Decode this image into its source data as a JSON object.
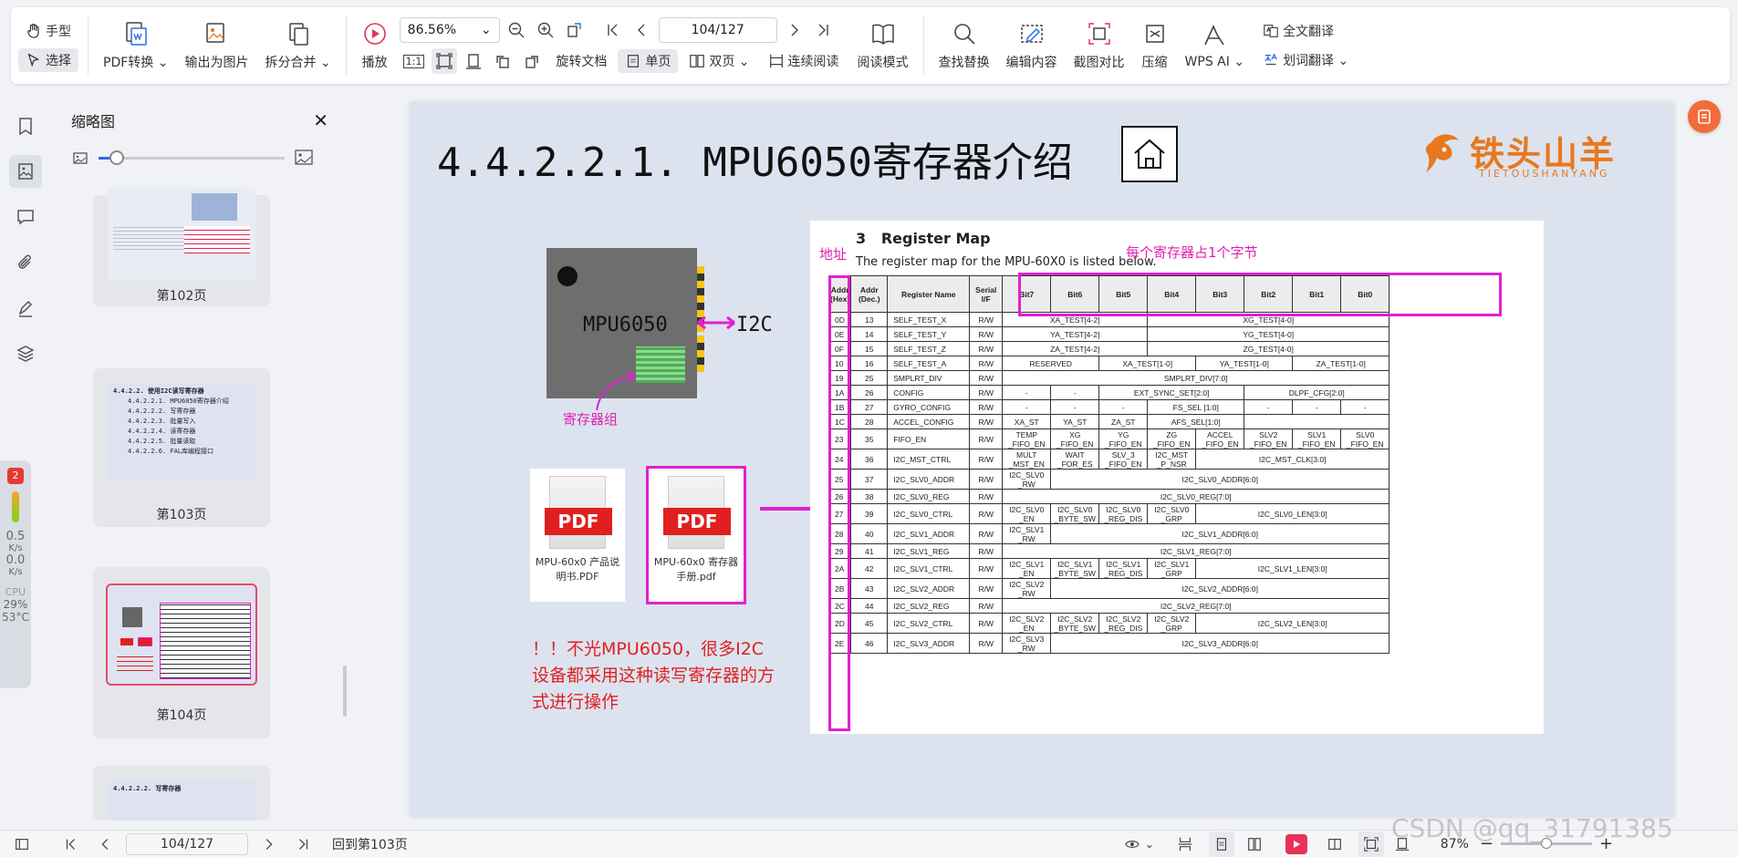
{
  "toolbar": {
    "hand_label": "手型",
    "select_label": "选择",
    "pdf_convert_label": "PDF转换",
    "export_image_label": "输出为图片",
    "split_merge_label": "拆分合并",
    "play_label": "播放",
    "zoom_value": "86.56%",
    "page_value": "104/127",
    "actual_size_label": "1:1",
    "rotate_doc_label": "旋转文档",
    "single_page_label": "单页",
    "double_page_label": "双页",
    "continuous_label": "连续阅读",
    "read_mode_label": "阅读模式",
    "find_replace_label": "查找替换",
    "edit_content_label": "编辑内容",
    "screenshot_compare_label": "截图对比",
    "compress_label": "压缩",
    "wps_ai_label": "WPS AI",
    "full_translate_label": "全文翻译",
    "word_translate_label": "划词翻译"
  },
  "thumbnail_panel": {
    "title": "缩略图",
    "slider_value": 0.1,
    "pages": [
      {
        "label": "第102页",
        "lines": []
      },
      {
        "label": "第103页",
        "lines": [
          "4.4.2.2. 使用I2C读写寄存器",
          "4.4.2.2.1. MPU6050寄存器介绍",
          "4.4.2.2.2. 写寄存器",
          "4.4.2.2.3. 批量写入",
          "4.4.2.2.4. 读寄存器",
          "4.4.2.2.5. 批量读取",
          "4.4.2.2.6. FAL库编程接口"
        ]
      },
      {
        "label": "第104页",
        "lines": []
      },
      {
        "label": "",
        "lines": [
          "4.4.2.2.2. 写寄存器"
        ]
      }
    ]
  },
  "monitor": {
    "badge": "2",
    "up_rate": "0.5",
    "up_unit": "K/s",
    "down_rate": "0.0",
    "down_unit": "K/s",
    "cpu_label": "CPU",
    "cpu_percent": "29%",
    "cpu_temp": "53°C"
  },
  "page": {
    "title": "4.4.2.2.1. MPU6050寄存器介绍",
    "logo_text": "铁头山羊",
    "logo_sub": "TIETOUSHANYANG",
    "chip_label": "MPU6050",
    "i2c_label": "I2C",
    "register_group_label": "寄存器组",
    "pdf1_caption": "MPU-60x0 产品说明书.PDF",
    "pdf2_caption": "MPU-60x0 寄存器手册.pdf",
    "pdf_badge": "PDF",
    "note": "！！不光MPU6050，很多I2C设备都采用这种读写寄存器的方式进行操作",
    "address_label": "地址",
    "byte_label": "每个寄存器占1个字节"
  },
  "register_map": {
    "heading_num": "3",
    "heading": "Register Map",
    "subtitle": "The register map for the MPU-60X0 is listed below.",
    "columns": [
      "Addr (Hex)",
      "Addr (Dec.)",
      "Register Name",
      "Serial I/F",
      "Bit7",
      "Bit6",
      "Bit5",
      "Bit4",
      "Bit3",
      "Bit2",
      "Bit1",
      "Bit0"
    ],
    "rows": [
      {
        "hex": "0D",
        "dec": "13",
        "name": "SELF_TEST_X",
        "rw": "R/W",
        "cells": [
          [
            "XA_TEST[4-2]",
            3
          ],
          [
            "XG_TEST[4-0]",
            5
          ]
        ]
      },
      {
        "hex": "0E",
        "dec": "14",
        "name": "SELF_TEST_Y",
        "rw": "R/W",
        "cells": [
          [
            "YA_TEST[4-2]",
            3
          ],
          [
            "YG_TEST[4-0]",
            5
          ]
        ]
      },
      {
        "hex": "0F",
        "dec": "15",
        "name": "SELF_TEST_Z",
        "rw": "R/W",
        "cells": [
          [
            "ZA_TEST[4-2]",
            3
          ],
          [
            "ZG_TEST[4-0]",
            5
          ]
        ]
      },
      {
        "hex": "10",
        "dec": "16",
        "name": "SELF_TEST_A",
        "rw": "R/W",
        "cells": [
          [
            "RESERVED",
            2
          ],
          [
            "XA_TEST[1-0]",
            2
          ],
          [
            "YA_TEST[1-0]",
            2
          ],
          [
            "ZA_TEST[1-0]",
            2
          ]
        ]
      },
      {
        "hex": "19",
        "dec": "25",
        "name": "SMPLRT_DIV",
        "rw": "R/W",
        "cells": [
          [
            "SMPLRT_DIV[7:0]",
            8
          ]
        ]
      },
      {
        "hex": "1A",
        "dec": "26",
        "name": "CONFIG",
        "rw": "R/W",
        "cells": [
          [
            "-",
            1
          ],
          [
            "-",
            1
          ],
          [
            "EXT_SYNC_SET[2:0]",
            3
          ],
          [
            "DLPF_CFG[2:0]",
            3
          ]
        ]
      },
      {
        "hex": "1B",
        "dec": "27",
        "name": "GYRO_CONFIG",
        "rw": "R/W",
        "cells": [
          [
            "-",
            1
          ],
          [
            "-",
            1
          ],
          [
            "-",
            1
          ],
          [
            "FS_SEL [1:0]",
            2
          ],
          [
            "-",
            1
          ],
          [
            "-",
            1
          ],
          [
            "-",
            1
          ]
        ]
      },
      {
        "hex": "1C",
        "dec": "28",
        "name": "ACCEL_CONFIG",
        "rw": "R/W",
        "cells": [
          [
            "XA_ST",
            1
          ],
          [
            "YA_ST",
            1
          ],
          [
            "ZA_ST",
            1
          ],
          [
            "AFS_SEL[1:0]",
            2
          ],
          [
            "",
            3
          ]
        ]
      },
      {
        "hex": "23",
        "dec": "35",
        "name": "FIFO_EN",
        "rw": "R/W",
        "cells": [
          [
            "TEMP _FIFO_EN",
            1
          ],
          [
            "XG _FIFO_EN",
            1
          ],
          [
            "YG _FIFO_EN",
            1
          ],
          [
            "ZG _FIFO_EN",
            1
          ],
          [
            "ACCEL _FIFO_EN",
            1
          ],
          [
            "SLV2 _FIFO_EN",
            1
          ],
          [
            "SLV1 _FIFO_EN",
            1
          ],
          [
            "SLV0 _FIFO_EN",
            1
          ]
        ]
      },
      {
        "hex": "24",
        "dec": "36",
        "name": "I2C_MST_CTRL",
        "rw": "R/W",
        "cells": [
          [
            "MULT _MST_EN",
            1
          ],
          [
            "WAIT _FOR_ES",
            1
          ],
          [
            "SLV_3 _FIFO_EN",
            1
          ],
          [
            "I2C_MST _P_NSR",
            1
          ],
          [
            "I2C_MST_CLK[3:0]",
            4
          ]
        ]
      },
      {
        "hex": "25",
        "dec": "37",
        "name": "I2C_SLV0_ADDR",
        "rw": "R/W",
        "cells": [
          [
            "I2C_SLV0 _RW",
            1
          ],
          [
            "I2C_SLV0_ADDR[6:0]",
            7
          ]
        ]
      },
      {
        "hex": "26",
        "dec": "38",
        "name": "I2C_SLV0_REG",
        "rw": "R/W",
        "cells": [
          [
            "I2C_SLV0_REG[7:0]",
            8
          ]
        ]
      },
      {
        "hex": "27",
        "dec": "39",
        "name": "I2C_SLV0_CTRL",
        "rw": "R/W",
        "cells": [
          [
            "I2C_SLV0 _EN",
            1
          ],
          [
            "I2C_SLV0 _BYTE_SW",
            1
          ],
          [
            "I2C_SLV0 _REG_DIS",
            1
          ],
          [
            "I2C_SLV0 _GRP",
            1
          ],
          [
            "I2C_SLV0_LEN[3:0]",
            4
          ]
        ]
      },
      {
        "hex": "28",
        "dec": "40",
        "name": "I2C_SLV1_ADDR",
        "rw": "R/W",
        "cells": [
          [
            "I2C_SLV1 _RW",
            1
          ],
          [
            "I2C_SLV1_ADDR[6:0]",
            7
          ]
        ]
      },
      {
        "hex": "29",
        "dec": "41",
        "name": "I2C_SLV1_REG",
        "rw": "R/W",
        "cells": [
          [
            "I2C_SLV1_REG[7:0]",
            8
          ]
        ]
      },
      {
        "hex": "2A",
        "dec": "42",
        "name": "I2C_SLV1_CTRL",
        "rw": "R/W",
        "cells": [
          [
            "I2C_SLV1 _EN",
            1
          ],
          [
            "I2C_SLV1 _BYTE_SW",
            1
          ],
          [
            "I2C_SLV1 _REG_DIS",
            1
          ],
          [
            "I2C_SLV1 _GRP",
            1
          ],
          [
            "I2C_SLV1_LEN[3:0]",
            4
          ]
        ]
      },
      {
        "hex": "2B",
        "dec": "43",
        "name": "I2C_SLV2_ADDR",
        "rw": "R/W",
        "cells": [
          [
            "I2C_SLV2 _RW",
            1
          ],
          [
            "I2C_SLV2_ADDR[6:0]",
            7
          ]
        ]
      },
      {
        "hex": "2C",
        "dec": "44",
        "name": "I2C_SLV2_REG",
        "rw": "R/W",
        "cells": [
          [
            "I2C_SLV2_REG[7:0]",
            8
          ]
        ]
      },
      {
        "hex": "2D",
        "dec": "45",
        "name": "I2C_SLV2_CTRL",
        "rw": "R/W",
        "cells": [
          [
            "I2C_SLV2 _EN",
            1
          ],
          [
            "I2C_SLV2 _BYTE_SW",
            1
          ],
          [
            "I2C_SLV2 _REG_DIS",
            1
          ],
          [
            "I2C_SLV2 _GRP",
            1
          ],
          [
            "I2C_SLV2_LEN[3:0]",
            4
          ]
        ]
      },
      {
        "hex": "2E",
        "dec": "46",
        "name": "I2C_SLV3_ADDR",
        "rw": "R/W",
        "cells": [
          [
            "I2C_SLV3 _RW",
            1
          ],
          [
            "I2C_SLV3_ADDR[6:0]",
            7
          ]
        ]
      }
    ]
  },
  "statusbar": {
    "page_value": "104/127",
    "back_label": "回到第103页",
    "zoom_value": "87%",
    "watermark": "CSDN @qq_31791385"
  },
  "colors": {
    "accent_pink": "#e020d0",
    "note_red": "#e02020",
    "logo_orange": "#e8781e",
    "page_bg": "#dce3ef"
  }
}
